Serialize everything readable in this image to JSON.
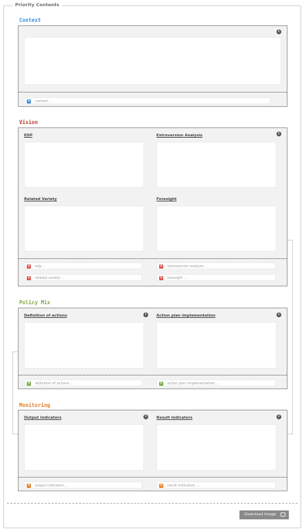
{
  "fieldset_legend": "Priority Contents",
  "colors": {
    "context": "#3d8fd8",
    "vision": "#c0392b",
    "policy_mix": "#7cab3c",
    "monitoring": "#e67e22"
  },
  "context": {
    "title": "Context",
    "info_icon": "info-icon",
    "placeholder": "context ..."
  },
  "vision": {
    "title": "Vision",
    "boxes": [
      {
        "label": "EDP",
        "placeholder": "edp ..."
      },
      {
        "label": "Extroversion Analysis",
        "placeholder": "extroversion analysis ..."
      },
      {
        "label": "Related Variety",
        "placeholder": "related variety ..."
      },
      {
        "label": "Foresight",
        "placeholder": "foresight ..."
      }
    ]
  },
  "policy_mix": {
    "title": "Policy Mix",
    "boxes": [
      {
        "label": "Definition of actions",
        "placeholder": "definition of actions ..."
      },
      {
        "label": "Action plan implementation",
        "placeholder": "action plan implementation ..."
      }
    ]
  },
  "monitoring": {
    "title": "Monitoring",
    "boxes": [
      {
        "label": "Output indicators",
        "placeholder": "output indicators ..."
      },
      {
        "label": "Result indicators",
        "placeholder": "result indicators ..."
      }
    ]
  },
  "footer": {
    "download_label": "Download Image",
    "download_icon": "image-icon"
  }
}
